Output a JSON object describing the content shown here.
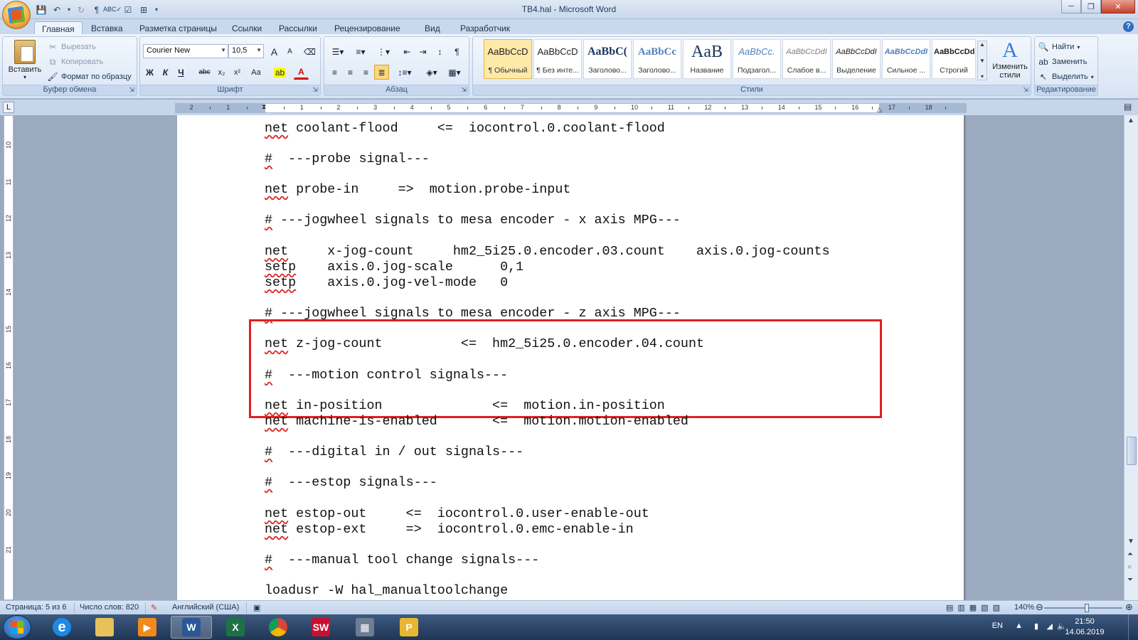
{
  "window": {
    "title": "TB4.hal - Microsoft Word"
  },
  "tabs": [
    "Главная",
    "Вставка",
    "Разметка страницы",
    "Ссылки",
    "Рассылки",
    "Рецензирование",
    "Вид",
    "Разработчик"
  ],
  "clipboard": {
    "paste": "Вставить",
    "cut": "Вырезать",
    "copy": "Копировать",
    "format_painter": "Формат по образцу",
    "group_label": "Буфер обмена"
  },
  "font": {
    "name": "Courier New",
    "size": "10,5",
    "group_label": "Шрифт",
    "bold": "Ж",
    "italic": "К",
    "underline": "Ч",
    "strike": "abc",
    "subscript": "x₂",
    "superscript": "x²",
    "case": "Aa",
    "grow": "A",
    "shrink": "A",
    "font_color": "A"
  },
  "paragraph": {
    "group_label": "Абзац"
  },
  "styles": {
    "group_label": "Стили",
    "items": [
      {
        "sample": "AaBbCcD",
        "name": "¶ Обычный"
      },
      {
        "sample": "AaBbCcD",
        "name": "¶ Без инте..."
      },
      {
        "sample": "AaBbC(",
        "name": "Заголово..."
      },
      {
        "sample": "AaBbCc",
        "name": "Заголово..."
      },
      {
        "sample": "AaB",
        "name": "Название"
      },
      {
        "sample": "AaBbCc.",
        "name": "Подзагол..."
      },
      {
        "sample": "AaBbCcDdI",
        "name": "Слабое в..."
      },
      {
        "sample": "AaBbCcDdI",
        "name": "Выделение"
      },
      {
        "sample": "AaBbCcDdI",
        "name": "Сильное ..."
      },
      {
        "sample": "AaBbCcDdE",
        "name": "Строгий"
      }
    ],
    "change_styles": "Изменить стили"
  },
  "editing": {
    "group_label": "Редактирование",
    "find": "Найти",
    "replace": "Заменить",
    "select": "Выделить"
  },
  "ruler_numbers": [
    "2",
    "1",
    "1",
    "2",
    "3",
    "4",
    "5",
    "6",
    "7",
    "8",
    "9",
    "10",
    "11",
    "12",
    "13",
    "14",
    "15",
    "16",
    "17",
    "18"
  ],
  "vruler_numbers": [
    "10",
    "11",
    "12",
    "13",
    "14",
    "15",
    "16",
    "17",
    "18",
    "19",
    "20",
    "21"
  ],
  "document": {
    "lines": [
      {
        "text": "net coolant-flood     <=  iocontrol.0.coolant-flood"
      },
      {
        "text": "#  ---probe signal---"
      },
      {
        "text": "net probe-in     =>  motion.probe-input"
      },
      {
        "text": "# ---jogwheel signals to mesa encoder - x axis MPG---"
      },
      {
        "text": "net     x-jog-count     hm2_5i25.0.encoder.03.count    axis.0.jog-counts"
      },
      {
        "text": "setp    axis.0.jog-scale      0,1"
      },
      {
        "text": "setp    axis.0.jog-vel-mode   0"
      },
      {
        "text": "# ---jogwheel signals to mesa encoder - z axis MPG---"
      },
      {
        "text": "net z-jog-count          <=  hm2_5i25.0.encoder.04.count"
      },
      {
        "text": "#  ---motion control signals---"
      },
      {
        "text": "net in-position              <=  motion.in-position"
      },
      {
        "text": "net machine-is-enabled       <=  motion.motion-enabled"
      },
      {
        "text": "#  ---digital in / out signals---"
      },
      {
        "text": "#  ---estop signals---"
      },
      {
        "text": "net estop-out     <=  iocontrol.0.user-enable-out"
      },
      {
        "text": "net estop-ext     =>  iocontrol.0.emc-enable-in"
      },
      {
        "text": "#  ---manual tool change signals---"
      },
      {
        "text": "loadusr -W hal_manualtoolchange"
      }
    ]
  },
  "status": {
    "page": "Страница: 5 из 6",
    "words": "Число слов: 820",
    "language": "Английский (США)",
    "zoom": "140%"
  },
  "taskbar": {
    "lang": "EN",
    "time": "21:50",
    "date": "14.06.2019",
    "apps": [
      {
        "name": "ie",
        "label": "e",
        "color": "#1e88e5"
      },
      {
        "name": "explorer",
        "label": "",
        "color": "#e7c15a"
      },
      {
        "name": "media-player",
        "label": "▶",
        "color": "#f08a1c"
      },
      {
        "name": "word",
        "label": "W",
        "color": "#2b5797"
      },
      {
        "name": "excel",
        "label": "X",
        "color": "#1e7145"
      },
      {
        "name": "chrome",
        "label": "",
        "color": "#db4437"
      },
      {
        "name": "solidworks",
        "label": "SW",
        "color": "#c8102e"
      },
      {
        "name": "calculator",
        "label": "▦",
        "color": "#6d7d95"
      },
      {
        "name": "powerpoint",
        "label": "P",
        "color": "#e8b631"
      }
    ]
  },
  "colors": {
    "highlight_border": "#e02020",
    "spell_underline": "#d22"
  }
}
